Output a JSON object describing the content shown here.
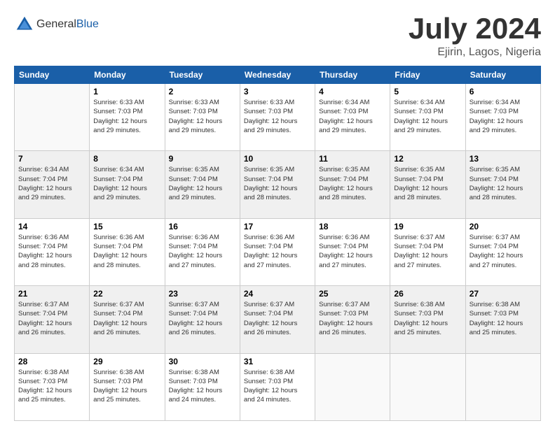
{
  "header": {
    "logo_general": "General",
    "logo_blue": "Blue",
    "month_year": "July 2024",
    "location": "Ejirin, Lagos, Nigeria"
  },
  "days_of_week": [
    "Sunday",
    "Monday",
    "Tuesday",
    "Wednesday",
    "Thursday",
    "Friday",
    "Saturday"
  ],
  "weeks": [
    [
      {
        "day": "",
        "info": ""
      },
      {
        "day": "1",
        "info": "Sunrise: 6:33 AM\nSunset: 7:03 PM\nDaylight: 12 hours\nand 29 minutes."
      },
      {
        "day": "2",
        "info": "Sunrise: 6:33 AM\nSunset: 7:03 PM\nDaylight: 12 hours\nand 29 minutes."
      },
      {
        "day": "3",
        "info": "Sunrise: 6:33 AM\nSunset: 7:03 PM\nDaylight: 12 hours\nand 29 minutes."
      },
      {
        "day": "4",
        "info": "Sunrise: 6:34 AM\nSunset: 7:03 PM\nDaylight: 12 hours\nand 29 minutes."
      },
      {
        "day": "5",
        "info": "Sunrise: 6:34 AM\nSunset: 7:03 PM\nDaylight: 12 hours\nand 29 minutes."
      },
      {
        "day": "6",
        "info": "Sunrise: 6:34 AM\nSunset: 7:03 PM\nDaylight: 12 hours\nand 29 minutes."
      }
    ],
    [
      {
        "day": "7",
        "info": "Sunrise: 6:34 AM\nSunset: 7:04 PM\nDaylight: 12 hours\nand 29 minutes."
      },
      {
        "day": "8",
        "info": "Sunrise: 6:34 AM\nSunset: 7:04 PM\nDaylight: 12 hours\nand 29 minutes."
      },
      {
        "day": "9",
        "info": "Sunrise: 6:35 AM\nSunset: 7:04 PM\nDaylight: 12 hours\nand 29 minutes."
      },
      {
        "day": "10",
        "info": "Sunrise: 6:35 AM\nSunset: 7:04 PM\nDaylight: 12 hours\nand 28 minutes."
      },
      {
        "day": "11",
        "info": "Sunrise: 6:35 AM\nSunset: 7:04 PM\nDaylight: 12 hours\nand 28 minutes."
      },
      {
        "day": "12",
        "info": "Sunrise: 6:35 AM\nSunset: 7:04 PM\nDaylight: 12 hours\nand 28 minutes."
      },
      {
        "day": "13",
        "info": "Sunrise: 6:35 AM\nSunset: 7:04 PM\nDaylight: 12 hours\nand 28 minutes."
      }
    ],
    [
      {
        "day": "14",
        "info": "Sunrise: 6:36 AM\nSunset: 7:04 PM\nDaylight: 12 hours\nand 28 minutes."
      },
      {
        "day": "15",
        "info": "Sunrise: 6:36 AM\nSunset: 7:04 PM\nDaylight: 12 hours\nand 28 minutes."
      },
      {
        "day": "16",
        "info": "Sunrise: 6:36 AM\nSunset: 7:04 PM\nDaylight: 12 hours\nand 27 minutes."
      },
      {
        "day": "17",
        "info": "Sunrise: 6:36 AM\nSunset: 7:04 PM\nDaylight: 12 hours\nand 27 minutes."
      },
      {
        "day": "18",
        "info": "Sunrise: 6:36 AM\nSunset: 7:04 PM\nDaylight: 12 hours\nand 27 minutes."
      },
      {
        "day": "19",
        "info": "Sunrise: 6:37 AM\nSunset: 7:04 PM\nDaylight: 12 hours\nand 27 minutes."
      },
      {
        "day": "20",
        "info": "Sunrise: 6:37 AM\nSunset: 7:04 PM\nDaylight: 12 hours\nand 27 minutes."
      }
    ],
    [
      {
        "day": "21",
        "info": "Sunrise: 6:37 AM\nSunset: 7:04 PM\nDaylight: 12 hours\nand 26 minutes."
      },
      {
        "day": "22",
        "info": "Sunrise: 6:37 AM\nSunset: 7:04 PM\nDaylight: 12 hours\nand 26 minutes."
      },
      {
        "day": "23",
        "info": "Sunrise: 6:37 AM\nSunset: 7:04 PM\nDaylight: 12 hours\nand 26 minutes."
      },
      {
        "day": "24",
        "info": "Sunrise: 6:37 AM\nSunset: 7:04 PM\nDaylight: 12 hours\nand 26 minutes."
      },
      {
        "day": "25",
        "info": "Sunrise: 6:37 AM\nSunset: 7:03 PM\nDaylight: 12 hours\nand 26 minutes."
      },
      {
        "day": "26",
        "info": "Sunrise: 6:38 AM\nSunset: 7:03 PM\nDaylight: 12 hours\nand 25 minutes."
      },
      {
        "day": "27",
        "info": "Sunrise: 6:38 AM\nSunset: 7:03 PM\nDaylight: 12 hours\nand 25 minutes."
      }
    ],
    [
      {
        "day": "28",
        "info": "Sunrise: 6:38 AM\nSunset: 7:03 PM\nDaylight: 12 hours\nand 25 minutes."
      },
      {
        "day": "29",
        "info": "Sunrise: 6:38 AM\nSunset: 7:03 PM\nDaylight: 12 hours\nand 25 minutes."
      },
      {
        "day": "30",
        "info": "Sunrise: 6:38 AM\nSunset: 7:03 PM\nDaylight: 12 hours\nand 24 minutes."
      },
      {
        "day": "31",
        "info": "Sunrise: 6:38 AM\nSunset: 7:03 PM\nDaylight: 12 hours\nand 24 minutes."
      },
      {
        "day": "",
        "info": ""
      },
      {
        "day": "",
        "info": ""
      },
      {
        "day": "",
        "info": ""
      }
    ]
  ]
}
